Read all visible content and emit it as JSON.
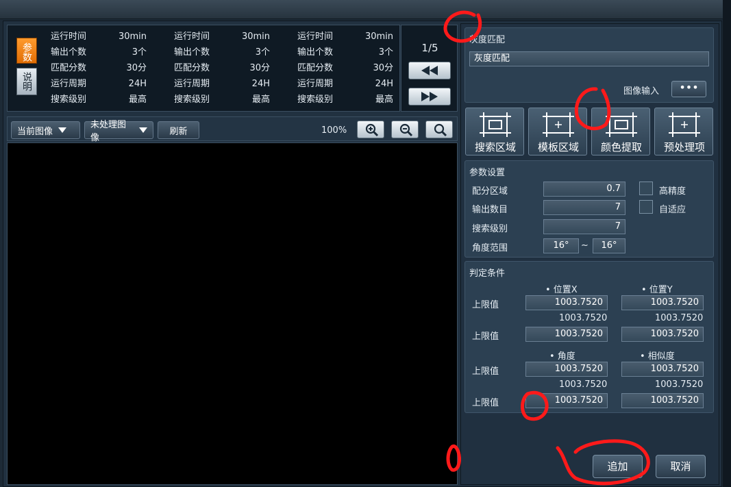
{
  "params": {
    "tabs": {
      "param": "参数",
      "desc": "说明"
    },
    "columns": [
      {
        "rows": [
          {
            "label": "运行时间",
            "value": "30min"
          },
          {
            "label": "输出个数",
            "value": "3个"
          },
          {
            "label": "匹配分数",
            "value": "30分"
          },
          {
            "label": "运行周期",
            "value": "24H"
          },
          {
            "label": "搜索级别",
            "value": "最高"
          }
        ]
      },
      {
        "rows": [
          {
            "label": "运行时间",
            "value": "30min"
          },
          {
            "label": "输出个数",
            "value": "3个"
          },
          {
            "label": "匹配分数",
            "value": "30分"
          },
          {
            "label": "运行周期",
            "value": "24H"
          },
          {
            "label": "搜索级别",
            "value": "最高"
          }
        ]
      },
      {
        "rows": [
          {
            "label": "运行时间",
            "value": "30min"
          },
          {
            "label": "输出个数",
            "value": "3个"
          },
          {
            "label": "匹配分数",
            "value": "30分"
          },
          {
            "label": "运行周期",
            "value": "24H"
          },
          {
            "label": "搜索级别",
            "value": "最高"
          }
        ]
      }
    ]
  },
  "pager": {
    "page": "1/5",
    "prev_icon": "rewind-icon",
    "next_icon": "fast-forward-icon"
  },
  "toolbar": {
    "current_image": "当前图像",
    "unprocessed_image": "未处理图像",
    "refresh": "刷新",
    "zoom": "100%",
    "icons": [
      "zoom-in-icon",
      "zoom-out-icon",
      "search-icon"
    ]
  },
  "gray_match": {
    "title": "灰度匹配",
    "name_value": "灰度匹配",
    "image_input_label": "图像输入",
    "dots_label": "•••"
  },
  "tools": [
    {
      "label": "搜索区域",
      "icon": "search-region-icon"
    },
    {
      "label": "模板区域",
      "icon": "template-region-icon"
    },
    {
      "label": "颜色提取",
      "icon": "color-extract-icon"
    },
    {
      "label": "预处理项",
      "icon": "preprocess-icon"
    }
  ],
  "param_settings": {
    "title": "参数设置",
    "score_region_label": "配分区域",
    "score_region_value": "0.7",
    "high_precision_label": "高精度",
    "output_count_label": "输出数目",
    "output_count_value": "7",
    "adaptive_label": "自适应",
    "search_level_label": "搜索级别",
    "search_level_value": "7",
    "angle_range_label": "角度范围",
    "angle_min": "16°",
    "angle_sep": "~",
    "angle_max": "16°"
  },
  "judge": {
    "title": "判定条件",
    "pos_x": "• 位置X",
    "pos_y": "• 位置Y",
    "angle": "• 角度",
    "similarity": "• 相似度",
    "upper_label": "上限值",
    "group1": {
      "upper_x": "1003.7520",
      "upper_y": "1003.7520",
      "mid_x": "1003.7520",
      "mid_y": "1003.7520",
      "lower_x": "1003.7520",
      "lower_y": "1003.7520"
    },
    "group2": {
      "upper_a": "1003.7520",
      "upper_s": "1003.7520",
      "mid_a": "1003.7520",
      "mid_s": "1003.7520",
      "lower_a": "1003.7520",
      "lower_s": "1003.7520"
    }
  },
  "actions": {
    "add": "追加",
    "cancel": "取消"
  },
  "colors": {
    "accent_orange": "#f08a1c",
    "annotation_red": "#ff1a1a",
    "viewer_bg": "#000000"
  }
}
